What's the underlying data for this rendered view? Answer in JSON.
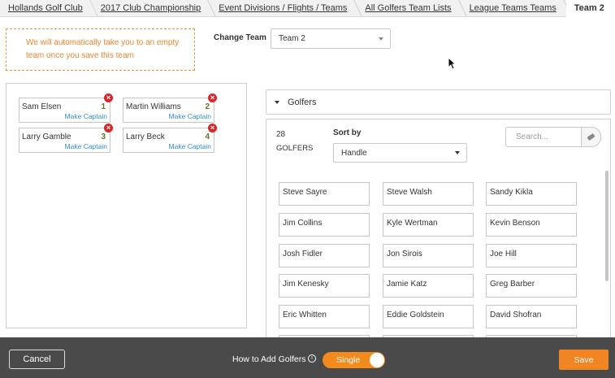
{
  "breadcrumb": [
    {
      "label": "Hollands Golf Club"
    },
    {
      "label": "2017 Club Championship"
    },
    {
      "label": "Event Divisions / Flights / Teams"
    },
    {
      "label": "All Golfers Team Lists"
    },
    {
      "label": "League Teams Teams"
    },
    {
      "label": "Team 2"
    }
  ],
  "notice": "We will automatically take you to an empty team once you save this team",
  "change_team": {
    "label": "Change Team",
    "selected": "Team 2"
  },
  "team_members": [
    {
      "name": "Sam Elsen",
      "number": "1",
      "captain_link": "Make Captain"
    },
    {
      "name": "Martin Williams",
      "number": "2",
      "captain_link": "Make Captain"
    },
    {
      "name": "Larry Gamble",
      "number": "3",
      "captain_link": "Make Captain"
    },
    {
      "name": "Larry Beck",
      "number": "4",
      "captain_link": "Make Captain"
    }
  ],
  "golfers_panel": {
    "title": "Golfers",
    "count": "28",
    "count_label": "GOLFERS",
    "sort_label": "Sort by",
    "sort_selected": "Handle",
    "search_placeholder": "Search..."
  },
  "golfers": [
    "Steve Sayre",
    "Steve Walsh",
    "Sandy Kikla",
    "Jim Collins",
    "Kyle Wertman",
    "Kevin Benson",
    "Josh Fidler",
    "Jon Sirois",
    "Joe Hill",
    "Jim Kenesky",
    "Jamie Katz",
    "Greg Barber",
    "Eric Whitten",
    "Eddie Goldstein",
    "David Shofran"
  ],
  "footer": {
    "cancel": "Cancel",
    "how_to_add": "How to Add Golfers",
    "toggle_label": "Single",
    "save": "Save"
  },
  "colors": {
    "accent": "#f08521",
    "link": "#2f8fd0",
    "remove": "#d8262b",
    "bar": "#4a4a4a"
  }
}
